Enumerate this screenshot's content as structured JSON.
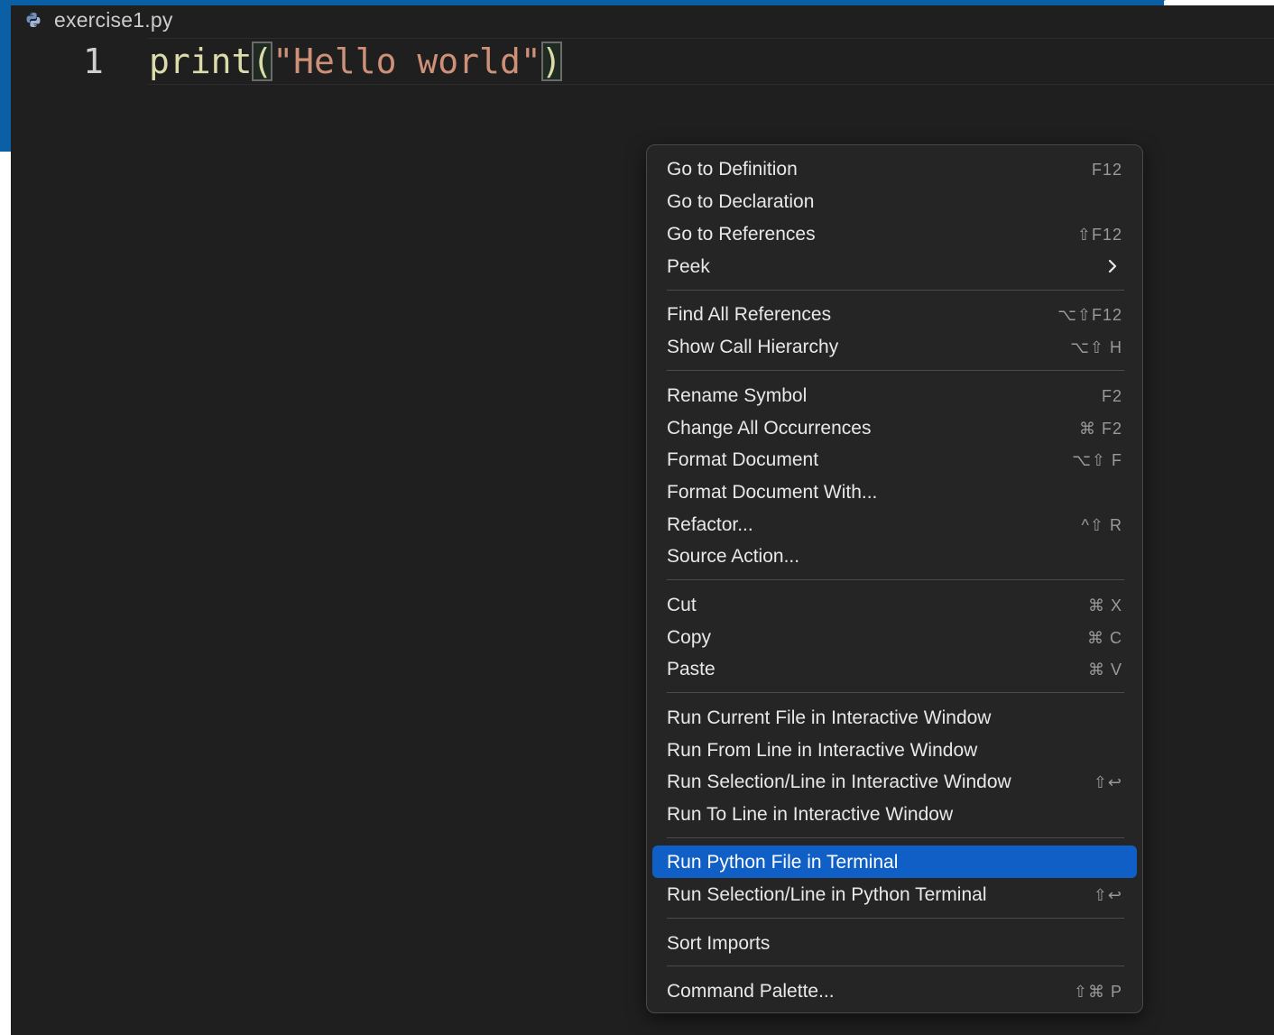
{
  "editor": {
    "file_name": "exercise1.py",
    "file_icon": "python-icon",
    "line_number": "1",
    "code": {
      "fn": "print",
      "open_paren": "(",
      "string": "\"Hello world\"",
      "close_paren": ")"
    }
  },
  "context_menu": {
    "items": [
      {
        "label": "Go to Definition",
        "shortcut": "F12"
      },
      {
        "label": "Go to Declaration",
        "shortcut": ""
      },
      {
        "label": "Go to References",
        "shortcut": "⇧F12"
      },
      {
        "label": "Peek",
        "shortcut": "",
        "submenu": true,
        "submenu_icon": "chevron-right-icon"
      },
      {
        "label": "Find All References",
        "shortcut": "⌥⇧F12"
      },
      {
        "label": "Show Call Hierarchy",
        "shortcut": "⌥⇧ H"
      },
      {
        "label": "Rename Symbol",
        "shortcut": "F2"
      },
      {
        "label": "Change All Occurrences",
        "shortcut": "⌘ F2"
      },
      {
        "label": "Format Document",
        "shortcut": "⌥⇧ F"
      },
      {
        "label": "Format Document With...",
        "shortcut": ""
      },
      {
        "label": "Refactor...",
        "shortcut": "^⇧ R"
      },
      {
        "label": "Source Action...",
        "shortcut": ""
      },
      {
        "label": "Cut",
        "shortcut": "⌘ X"
      },
      {
        "label": "Copy",
        "shortcut": "⌘ C"
      },
      {
        "label": "Paste",
        "shortcut": "⌘ V"
      },
      {
        "label": "Run Current File in Interactive Window",
        "shortcut": ""
      },
      {
        "label": "Run From Line in Interactive Window",
        "shortcut": ""
      },
      {
        "label": "Run Selection/Line in Interactive Window",
        "shortcut": "⇧↩"
      },
      {
        "label": "Run To Line in Interactive Window",
        "shortcut": ""
      },
      {
        "label": "Run Python File in Terminal",
        "shortcut": "",
        "selected": true
      },
      {
        "label": "Run Selection/Line in Python Terminal",
        "shortcut": "⇧↩"
      },
      {
        "label": "Sort Imports",
        "shortcut": ""
      },
      {
        "label": "Command Palette...",
        "shortcut": "⇧⌘ P"
      }
    ]
  },
  "colors": {
    "accent_blue": "#0b5fa5",
    "selection_blue": "#0f5fc6",
    "editor_bg": "#1f1f1f",
    "menu_bg": "#252526",
    "string_color": "#ce9178",
    "function_color": "#dcdcaa"
  }
}
